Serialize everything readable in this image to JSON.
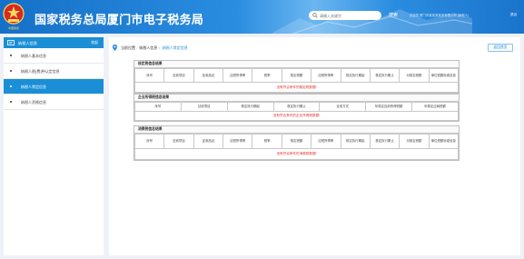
{
  "header": {
    "title": "国家税务总局厦门市电子税务局",
    "emblem_text": "中国税务",
    "search_placeholder": "请输入关键字",
    "search_label": "搜索",
    "welcome": "欢迎您,厦门市某某某某某有限公司 (纳税人)",
    "logout_label": "退出"
  },
  "sidebar": {
    "title": "纳税人信息",
    "collapse_label": "收起",
    "items": [
      {
        "label": "纳税人基本信息",
        "active": false
      },
      {
        "label": "纳税人税(费)种认定信息",
        "active": false
      },
      {
        "label": "纳税人常定信息",
        "active": true
      },
      {
        "label": "纳税人资格信息",
        "active": false
      }
    ]
  },
  "main": {
    "breadcrumb": {
      "label": "当前位置",
      "parent": "纳税人信息",
      "current": "纳税人常定信息"
    },
    "back_label": "返回首页",
    "sections": [
      {
        "title": "核定税信息结果",
        "columns": [
          "序号",
          "征收项目",
          "征收品目",
          "应税所得率",
          "税率",
          "核定税额",
          "应税所得率",
          "核定执行期起",
          "核定执行期止",
          "月核定税额",
          "单位税额标准信息"
        ],
        "empty_message": "没有符合条件的核定税数据!"
      },
      {
        "title": "企业所得税信息结果",
        "columns": [
          "序号",
          "征收项目",
          "核定执行期起",
          "核定执行期止",
          "征收方式",
          "年核定应纳所得税额",
          "年核定应纳税额"
        ],
        "empty_message": "没有符合条件的企业所得税数据!"
      },
      {
        "title": "消费税信息结果",
        "columns": [
          "序号",
          "征收项目",
          "征收品目",
          "应税所得率",
          "税率",
          "核定税额",
          "应税所得率",
          "核定执行期起",
          "核定执行期止",
          "月核定税额",
          "单位税额标准信息"
        ],
        "empty_message": "没有符合条件的消费税数据!"
      }
    ]
  },
  "colors": {
    "primary": "#1a8fd6",
    "header": "#1570c8",
    "error": "#e03030"
  }
}
